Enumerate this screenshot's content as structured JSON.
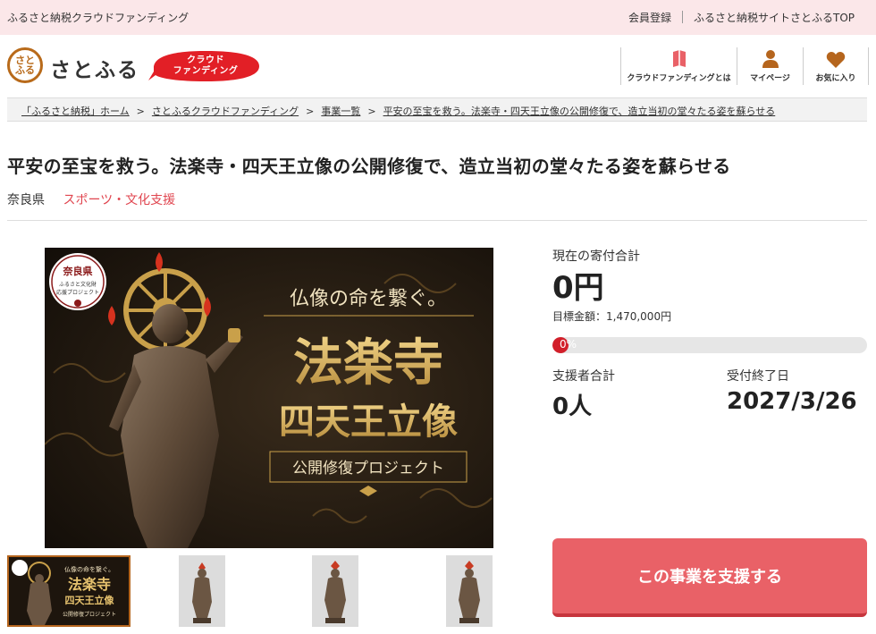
{
  "topbar": {
    "left_text": "ふるさと納税クラウドファンディング",
    "register": "会員登録",
    "top_link": "ふるさと納税サイトさとふるTOP"
  },
  "header": {
    "logo_mark": "さと ふる",
    "logo_text": "さとふる",
    "cf_badge_line1": "クラウド",
    "cf_badge_line2": "ファンディング",
    "nav": [
      {
        "label": "クラウドファンディングとは",
        "icon": "book-icon"
      },
      {
        "label": "マイページ",
        "icon": "person-icon"
      },
      {
        "label": "お気に入り",
        "icon": "heart-icon"
      }
    ]
  },
  "breadcrumb": [
    "「ふるさと納税」ホーム",
    "さとふるクラウドファンディング",
    "事業一覧",
    "平安の至宝を救う。法楽寺・四天王立像の公開修復で、造立当初の堂々たる姿を蘇らせる"
  ],
  "project": {
    "title": "平安の至宝を救う。法楽寺・四天王立像の公開修復で、造立当初の堂々たる姿を蘇らせる",
    "prefecture": "奈良県",
    "category": "スポーツ・文化支援"
  },
  "image": {
    "badge_line1": "奈良県",
    "badge_line2": "ふるさと文化財",
    "badge_line3": "応援プロジェクト",
    "tagline": "仏像の命を繋ぐ。",
    "headline1": "法楽寺",
    "headline2": "四天王立像",
    "subline": "公開修復プロジェクト"
  },
  "thumbnail_text": {
    "tagline": "仏像の命を繋ぐ。",
    "headline1": "法楽寺",
    "headline2": "四天王立像",
    "subline": "公開修復プロジェクト"
  },
  "funding": {
    "total_label": "現在の寄付合計",
    "total_value": "0円",
    "goal_text": "目標金額：1,470,000円",
    "progress_text": "0%",
    "progress": 0,
    "supporters_label": "支援者合計",
    "supporters_value": "0人",
    "deadline_label": "受付終了日",
    "deadline_value": "2027/3/26",
    "cta_label": "この事業を支援する"
  },
  "colors": {
    "accent": "#e96167",
    "topbar_bg": "#fbe7e9",
    "category": "#e0454f",
    "progress_fill": "#d21f2a",
    "gold": "#d9b25a"
  }
}
